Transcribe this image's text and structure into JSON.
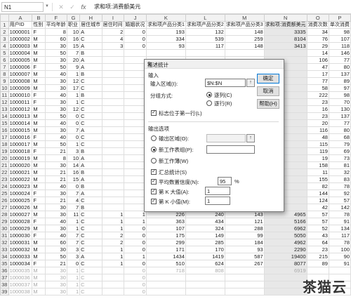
{
  "formula_bar": {
    "name_box": "N1",
    "cancel_icon": "✕",
    "enter_icon": "✓",
    "fx_label": "fx",
    "content": "求和项:消费额美元"
  },
  "columns": [
    "A",
    "B",
    "F",
    "G",
    "H",
    "I",
    "J",
    "K",
    "L",
    "M",
    "N",
    "O",
    "P"
  ],
  "selected_column": "N",
  "header_row": [
    "用户ID",
    "性别",
    "平均年龄",
    "职业",
    "居住城市",
    "居住时间",
    "婚姻状况",
    "求和项产品分类1",
    "求和项产品分类2",
    "求和项产品分类3",
    "求和项:消费额美元",
    "消费次数",
    "单次消费"
  ],
  "rows": [
    [
      "1000001",
      "F",
      "8",
      "10",
      "A",
      "2",
      "0",
      "193",
      "132",
      "148",
      "3335",
      "34",
      "98"
    ],
    [
      "1000002",
      "M",
      "60",
      "16",
      "C",
      "4",
      "0",
      "334",
      "539",
      "259",
      "8104",
      "76",
      "107"
    ],
    [
      "1000003",
      "M",
      "30",
      "15",
      "A",
      "3",
      "0",
      "93",
      "117",
      "148",
      "3413",
      "29",
      "118"
    ],
    [
      "1000004",
      "M",
      "50",
      "7",
      "B",
      "",
      "",
      "",
      "",
      "",
      "",
      "14",
      "146"
    ],
    [
      "1000005",
      "M",
      "30",
      "20",
      "A",
      "",
      "",
      "",
      "",
      "",
      "",
      "106",
      "77"
    ],
    [
      "1000006",
      "F",
      "50",
      "9",
      "A",
      "",
      "",
      "",
      "",
      "",
      "",
      "47",
      "80"
    ],
    [
      "1000007",
      "M",
      "40",
      "1",
      "B",
      "",
      "",
      "",
      "",
      "",
      "",
      "17",
      "137"
    ],
    [
      "1000008",
      "M",
      "30",
      "12",
      "C",
      "",
      "",
      "",
      "",
      "",
      "",
      "77",
      "89"
    ],
    [
      "1000009",
      "M",
      "30",
      "17",
      "C",
      "",
      "",
      "",
      "",
      "",
      "",
      "58",
      "97"
    ],
    [
      "1000010",
      "F",
      "40",
      "1",
      "B",
      "",
      "",
      "",
      "",
      "",
      "",
      "222",
      "98"
    ],
    [
      "1000011",
      "F",
      "30",
      "1",
      "C",
      "",
      "",
      "",
      "",
      "",
      "",
      "23",
      "70"
    ],
    [
      "1000012",
      "M",
      "30",
      "12",
      "C",
      "",
      "",
      "",
      "",
      "",
      "",
      "16",
      "130"
    ],
    [
      "1000013",
      "M",
      "50",
      "0",
      "C",
      "",
      "",
      "",
      "",
      "",
      "",
      "23",
      "137"
    ],
    [
      "1000014",
      "M",
      "40",
      "0",
      "C",
      "",
      "",
      "",
      "",
      "",
      "",
      "20",
      "77"
    ],
    [
      "1000015",
      "M",
      "30",
      "7",
      "A",
      "",
      "",
      "",
      "",
      "",
      "",
      "116",
      "80"
    ],
    [
      "1000016",
      "F",
      "40",
      "0",
      "C",
      "",
      "",
      "",
      "",
      "",
      "",
      "48",
      "68"
    ],
    [
      "1000017",
      "M",
      "50",
      "1",
      "C",
      "",
      "",
      "",
      "",
      "",
      "",
      "115",
      "79"
    ],
    [
      "1000018",
      "F",
      "21",
      "3",
      "B",
      "",
      "",
      "",
      "",
      "",
      "",
      "119",
      "69"
    ],
    [
      "1000019",
      "M",
      "8",
      "10",
      "A",
      "",
      "",
      "",
      "",
      "",
      "",
      "19",
      "73"
    ],
    [
      "1000020",
      "M",
      "30",
      "14",
      "A",
      "",
      "",
      "",
      "",
      "",
      "",
      "158",
      "81"
    ],
    [
      "1000021",
      "M",
      "21",
      "16",
      "B",
      "",
      "",
      "",
      "",
      "",
      "",
      "11",
      "32"
    ],
    [
      "1000022",
      "M",
      "21",
      "15",
      "A",
      "",
      "",
      "",
      "",
      "",
      "",
      "155",
      "83"
    ],
    [
      "1000023",
      "M",
      "40",
      "0",
      "B",
      "",
      "",
      "",
      "",
      "",
      "",
      "82",
      "78"
    ],
    [
      "1000024",
      "F",
      "30",
      "7",
      "A",
      "",
      "",
      "",
      "",
      "",
      "",
      "144",
      "92"
    ],
    [
      "1000025",
      "F",
      "21",
      "4",
      "C",
      "",
      "",
      "",
      "",
      "",
      "",
      "124",
      "57"
    ],
    [
      "1000026",
      "M",
      "30",
      "7",
      "B",
      "",
      "",
      "",
      "",
      "",
      "",
      "42",
      "142"
    ],
    [
      "1000027",
      "M",
      "30",
      "11",
      "C",
      "1",
      "1",
      "226",
      "240",
      "143",
      "4965",
      "57",
      "78"
    ],
    [
      "1000028",
      "F",
      "40",
      "1",
      "C",
      "1",
      "1",
      "363",
      "434",
      "121",
      "5166",
      "57",
      "91"
    ],
    [
      "1000029",
      "M",
      "30",
      "1",
      "C",
      "1",
      "0",
      "107",
      "324",
      "288",
      "6962",
      "52",
      "134"
    ],
    [
      "1000030",
      "F",
      "40",
      "7",
      "C",
      "2",
      "0",
      "175",
      "149",
      "99",
      "5050",
      "43",
      "117"
    ],
    [
      "1000031",
      "M",
      "60",
      "7",
      "C",
      "2",
      "0",
      "299",
      "285",
      "184",
      "4962",
      "64",
      "78"
    ],
    [
      "1000032",
      "M",
      "30",
      "3",
      "C",
      "1",
      "0",
      "171",
      "170",
      "93",
      "2290",
      "23",
      "100"
    ],
    [
      "1000033",
      "M",
      "50",
      "3",
      "A",
      "1",
      "1",
      "1434",
      "1419",
      "587",
      "19400",
      "215",
      "90"
    ],
    [
      "1000034",
      "F",
      "21",
      "0",
      "C",
      "1",
      "0",
      "510",
      "624",
      "267",
      "8077",
      "89",
      "91"
    ],
    [
      "1000035",
      "M",
      "30",
      "1",
      "C",
      "",
      "0",
      "718",
      "808",
      "",
      "6919",
      "",
      ""
    ],
    [
      "1000036",
      "M",
      "30",
      "1",
      "C",
      "",
      "0",
      "",
      "",
      "",
      "",
      "",
      ""
    ],
    [
      "1000037",
      "M",
      "30",
      "1",
      "C",
      "",
      "0",
      "",
      "",
      "",
      "",
      "",
      ""
    ],
    [
      "1000038",
      "M",
      "30",
      "1",
      "C",
      "",
      "0",
      "",
      "",
      "",
      "",
      "",
      ""
    ]
  ],
  "dialog": {
    "title": "描述统计",
    "help_glyph": "?",
    "close_glyph": "×",
    "input_section": "输入",
    "input_range_label": "输入区域(I):",
    "input_range_value": "$N:$N",
    "ref_glyph": "↑",
    "group_by_label": "分组方式:",
    "group_by_columns": "逐列(C)",
    "group_by_rows": "逐行(R)",
    "labels_first_row": "标志位于第一行(L)",
    "ok_button": "确定",
    "cancel_button": "取消",
    "help_button": "帮助(H)",
    "output_section": "输出选项",
    "output_range_label": "输出区域(O):",
    "new_sheet_label": "新工作表组(P):",
    "new_workbook_label": "新工作薄(W)",
    "summary_stats_label": "汇总统计(S)",
    "confidence_label": "平均数置信度(N):",
    "confidence_value": "95",
    "percent_sign": "%",
    "kth_largest_label": "第 K 大值(A):",
    "kth_largest_value": "1",
    "kth_smallest_label": "第 K 小值(M):",
    "kth_smallest_value": "1",
    "check_glyph": "✓"
  },
  "watermark": "茶猫云"
}
